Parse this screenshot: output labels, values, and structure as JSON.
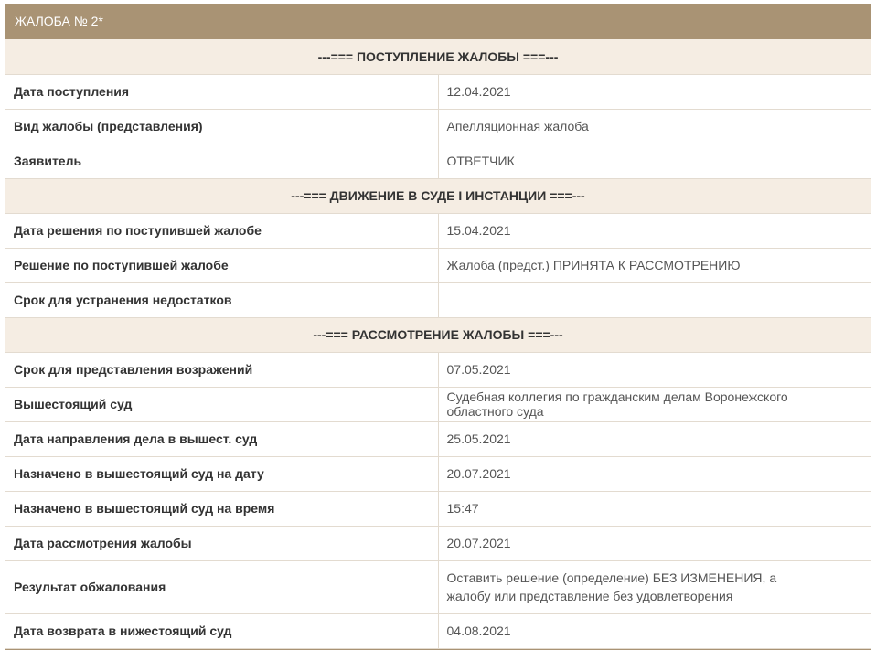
{
  "panel": {
    "title": "ЖАЛОБА № 2*"
  },
  "sections": [
    {
      "title": "---=== ПОСТУПЛЕНИЕ ЖАЛОБЫ ===---",
      "rows": [
        {
          "label": "Дата поступления",
          "value": "12.04.2021"
        },
        {
          "label": "Вид жалобы (представления)",
          "value": "Апелляционная жалоба"
        },
        {
          "label": "Заявитель",
          "value": "ОТВЕТЧИК"
        }
      ]
    },
    {
      "title": "---=== ДВИЖЕНИЕ В СУДЕ I ИНСТАНЦИИ ===---",
      "rows": [
        {
          "label": "Дата решения по поступившей жалобе",
          "value": "15.04.2021"
        },
        {
          "label": "Решение по поступившей жалобе",
          "value": "Жалоба (предст.) ПРИНЯТА К РАССМОТРЕНИЮ"
        },
        {
          "label": "Срок для устранения недостатков",
          "value": ""
        }
      ]
    },
    {
      "title": "---=== РАССМОТРЕНИЕ ЖАЛОБЫ ===---",
      "rows": [
        {
          "label": "Срок для представления возражений",
          "value": "07.05.2021"
        },
        {
          "label": "Вышестоящий суд",
          "value": "Судебная коллегия по гражданским делам Воронежского областного суда"
        },
        {
          "label": "Дата направления дела в вышест. суд",
          "value": "25.05.2021"
        },
        {
          "label": "Назначено в вышестоящий суд на дату",
          "value": "20.07.2021"
        },
        {
          "label": "Назначено в вышестоящий суд на время",
          "value": "15:47"
        },
        {
          "label": "Дата рассмотрения жалобы",
          "value": "20.07.2021"
        },
        {
          "label": "Результат обжалования",
          "value": "Оставить решение (определение) БЕЗ ИЗМЕНЕНИЯ, а жалобу или представление без удовлетворения"
        },
        {
          "label": "Дата возврата в нижестоящий суд",
          "value": "04.08.2021"
        }
      ]
    }
  ]
}
